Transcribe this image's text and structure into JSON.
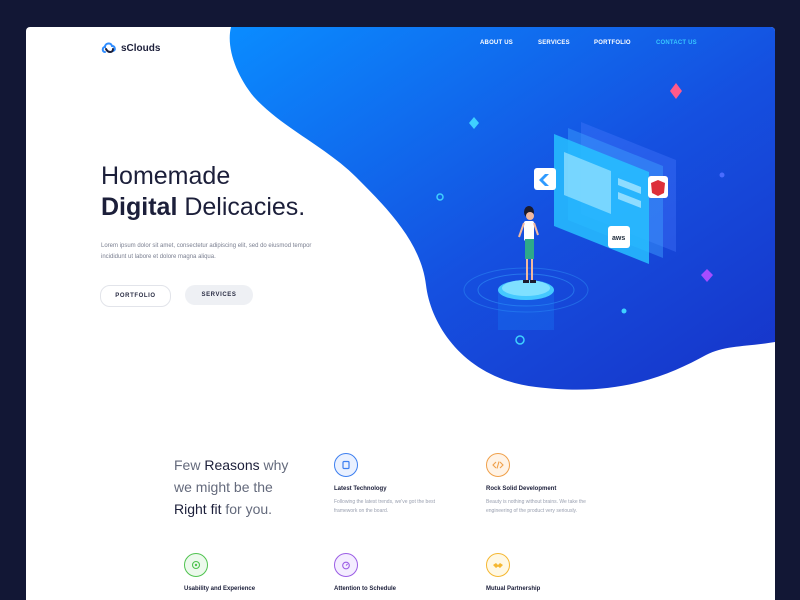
{
  "brand": {
    "name": "sClouds"
  },
  "nav": {
    "items": [
      {
        "label": "ABOUT US"
      },
      {
        "label": "SERVICES"
      },
      {
        "label": "PORTFOLIO"
      },
      {
        "label": "CONTACT US",
        "active": true
      }
    ]
  },
  "hero": {
    "title_line1": "Homemade",
    "title_bold": "Digital",
    "title_rest": " Delicacies.",
    "description": "Lorem ipsum dolor sit amet, consectetur adipiscing elit, sed do eiusmod tempor incididunt ut labore et dolore magna aliqua.",
    "buttons": {
      "portfolio": "PORTFOLIO",
      "services": "SERVICES"
    }
  },
  "illustration": {
    "badges": {
      "aws": "aws"
    }
  },
  "reasons": {
    "line1_pre": "Few ",
    "line1_bold": "Reasons",
    "line1_post": " why",
    "line2": "we might be the",
    "line3_bold": "Right fit",
    "line3_post": " for you."
  },
  "features": [
    {
      "title": "Latest Technology",
      "description": "Following the latest trends, we've got the best framework on the board.",
      "icon": "tablet-icon",
      "color": "#3d7ff0"
    },
    {
      "title": "Rock Solid Development",
      "description": "Beauty is nothing without brains. We take the engineering of the product very seriously.",
      "icon": "code-icon",
      "color": "#f0a04a"
    },
    {
      "title": "Usability and Experience",
      "description": "",
      "icon": "target-icon",
      "color": "#4fc34f"
    },
    {
      "title": "Attention to Schedule",
      "description": "",
      "icon": "timer-icon",
      "color": "#9b5de5"
    },
    {
      "title": "Mutual Partnership",
      "description": "",
      "icon": "handshake-icon",
      "color": "#f5b731"
    }
  ],
  "colors": {
    "blob_start": "#0a8cff",
    "blob_end": "#1733c8",
    "background": "#121735",
    "accent": "#37c8ff"
  }
}
